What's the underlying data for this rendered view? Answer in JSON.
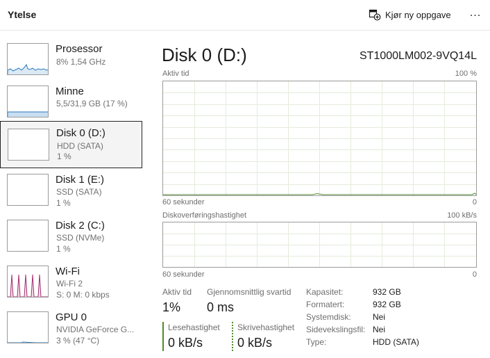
{
  "header": {
    "title": "Ytelse",
    "run_task_label": "Kjør ny oppgave",
    "more_label": "..."
  },
  "sidebar": {
    "items": [
      {
        "name": "Prosessor",
        "sub1": "8%  1,54 GHz",
        "sub2": "",
        "color": "#2b7bbf"
      },
      {
        "name": "Minne",
        "sub1": "5,5/31,9 GB (17 %)",
        "sub2": "",
        "color": "#2b7bbf"
      },
      {
        "name": "Disk 0 (D:)",
        "sub1": "HDD (SATA)",
        "sub2": "1 %",
        "color": "#4f8a2b"
      },
      {
        "name": "Disk 1 (E:)",
        "sub1": "SSD (SATA)",
        "sub2": "1 %",
        "color": "#4f8a2b"
      },
      {
        "name": "Disk 2 (C:)",
        "sub1": "SSD (NVMe)",
        "sub2": "1 %",
        "color": "#4f8a2b"
      },
      {
        "name": "Wi-Fi",
        "sub1": "Wi-Fi 2",
        "sub2": "S: 0  M: 0 kbps",
        "color": "#a3306f"
      },
      {
        "name": "GPU 0",
        "sub1": "NVIDIA GeForce G...",
        "sub2": "3 %  (47 °C)",
        "color": "#2b7bbf"
      }
    ]
  },
  "main": {
    "title": "Disk 0 (D:)",
    "model": "ST1000LM002-9VQ14L",
    "graph1": {
      "label": "Aktiv tid",
      "max": "100 %",
      "time": "60 sekunder",
      "min": "0"
    },
    "graph2": {
      "label": "Diskoverføringshastighet",
      "max": "100 kB/s",
      "time": "60 sekunder",
      "min": "0"
    },
    "stats": {
      "active_time_label": "Aktiv tid",
      "active_time_value": "1%",
      "response_label": "Gjennomsnittlig svartid",
      "response_value": "0 ms",
      "read_label": "Lesehastighet",
      "read_value": "0 kB/s",
      "write_label": "Skrivehastighet",
      "write_value": "0 kB/s"
    },
    "info": [
      {
        "key": "Kapasitet:",
        "value": "932 GB"
      },
      {
        "key": "Formatert:",
        "value": "932 GB"
      },
      {
        "key": "Systemdisk:",
        "value": "Nei"
      },
      {
        "key": "Sidevekslingsfil:",
        "value": "Nei"
      },
      {
        "key": "Type:",
        "value": "HDD (SATA)"
      }
    ]
  }
}
